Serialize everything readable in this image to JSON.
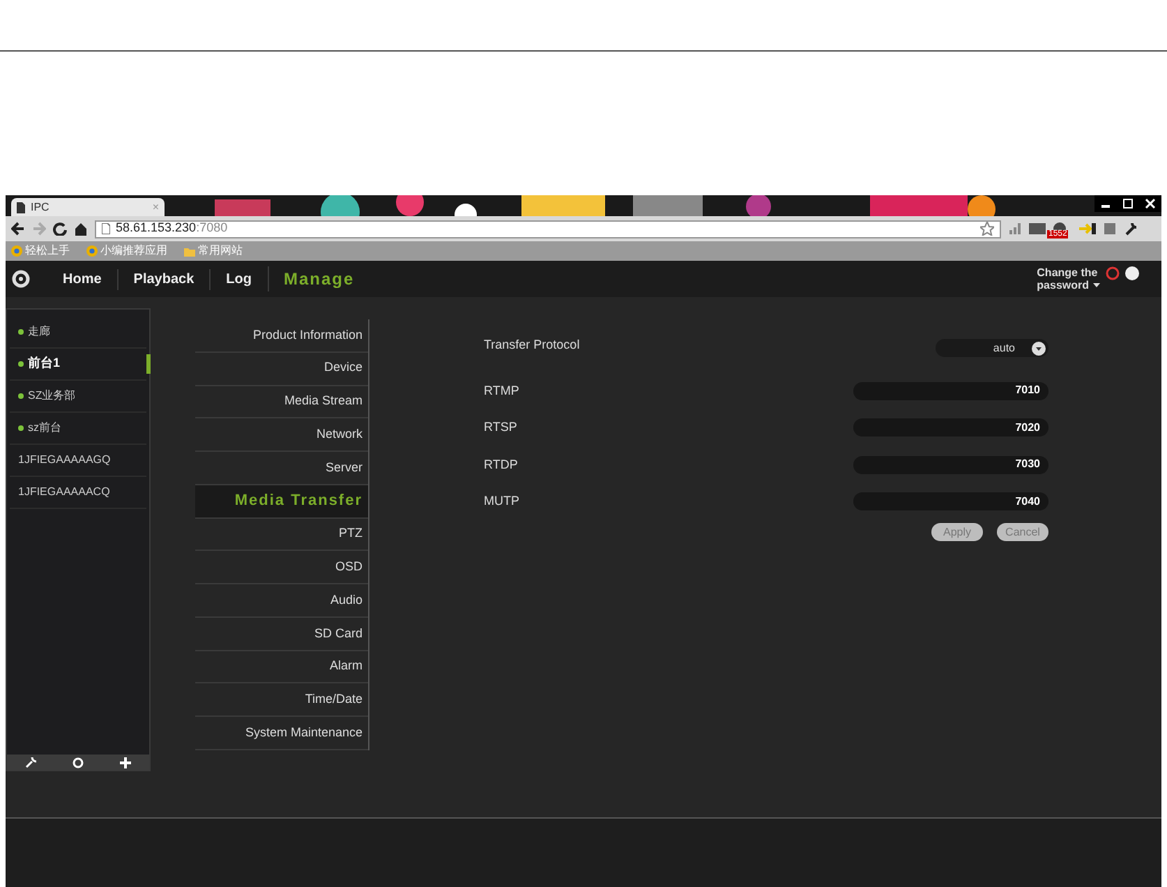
{
  "browser": {
    "tab_title": "IPC",
    "tab_close": "×",
    "address_host": "58.61.153.230",
    "address_port": ":7080",
    "bookmarks": [
      "轻松上手",
      "小编推荐应用",
      "常用网站"
    ],
    "badge": "1552"
  },
  "nav": {
    "items": [
      {
        "label": "Home",
        "selected": false
      },
      {
        "label": "Playback",
        "selected": false
      },
      {
        "label": "Log",
        "selected": false
      },
      {
        "label": "Manage",
        "selected": true
      }
    ],
    "account_line1": "Change the",
    "account_line2": "password"
  },
  "devices": [
    {
      "name": "走廊",
      "online": true,
      "selected": false
    },
    {
      "name": "前台1",
      "online": true,
      "selected": true
    },
    {
      "name": "SZ业务部",
      "online": true,
      "selected": false
    },
    {
      "name": "sz前台",
      "online": true,
      "selected": false
    },
    {
      "name": "1JFIEGAAAAAGQ",
      "online": false,
      "selected": false
    },
    {
      "name": "1JFIEGAAAAACQ",
      "online": false,
      "selected": false
    }
  ],
  "menu": [
    {
      "label": "Product Information",
      "selected": false
    },
    {
      "label": "Device",
      "selected": false
    },
    {
      "label": "Media Stream",
      "selected": false
    },
    {
      "label": "Network",
      "selected": false
    },
    {
      "label": "Server",
      "selected": false
    },
    {
      "label": "Media Transfer",
      "selected": true
    },
    {
      "label": "PTZ",
      "selected": false
    },
    {
      "label": "OSD",
      "selected": false
    },
    {
      "label": "Audio",
      "selected": false
    },
    {
      "label": "SD Card",
      "selected": false
    },
    {
      "label": "Alarm",
      "selected": false
    },
    {
      "label": "Time/Date",
      "selected": false
    },
    {
      "label": "System Maintenance",
      "selected": false
    }
  ],
  "form": {
    "fields": [
      {
        "kind": "select",
        "label": "Transfer Protocol",
        "value": "auto"
      },
      {
        "kind": "input",
        "label": "RTMP",
        "value": "7010"
      },
      {
        "kind": "input",
        "label": "RTSP",
        "value": "7020"
      },
      {
        "kind": "input",
        "label": "RTDP",
        "value": "7030"
      },
      {
        "kind": "input",
        "label": "MUTP",
        "value": "7040"
      }
    ],
    "buttons": [
      "Apply",
      "Cancel"
    ]
  }
}
